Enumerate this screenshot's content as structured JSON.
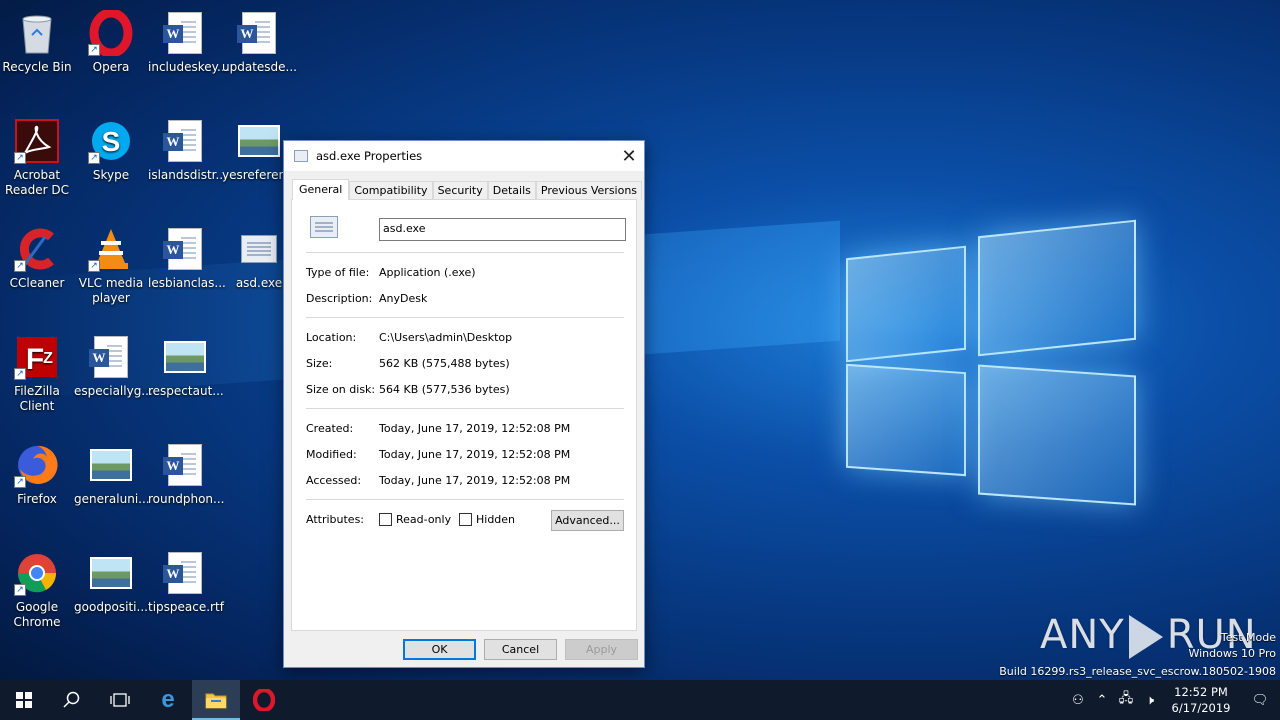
{
  "desktop": {
    "icons": [
      {
        "label": "Recycle Bin",
        "icon": "recycle-bin-icon"
      },
      {
        "label": "Opera",
        "icon": "opera-icon"
      },
      {
        "label": "includeskey...",
        "icon": "word-document-icon"
      },
      {
        "label": "updatesde...",
        "icon": "word-document-icon"
      },
      {
        "label": "Acrobat Reader DC",
        "icon": "acrobat-icon"
      },
      {
        "label": "Skype",
        "icon": "skype-icon"
      },
      {
        "label": "islandsdistr...",
        "icon": "word-document-icon"
      },
      {
        "label": "yesreferen...",
        "icon": "image-file-icon"
      },
      {
        "label": "CCleaner",
        "icon": "ccleaner-icon"
      },
      {
        "label": "VLC media player",
        "icon": "vlc-icon"
      },
      {
        "label": "lesbianclas...",
        "icon": "word-document-icon"
      },
      {
        "label": "asd.exe",
        "icon": "executable-icon"
      },
      {
        "label": "FileZilla Client",
        "icon": "filezilla-icon"
      },
      {
        "label": "especiallyg...",
        "icon": "word-document-icon"
      },
      {
        "label": "respectaut...",
        "icon": "image-file-icon"
      },
      {
        "label": "Firefox",
        "icon": "firefox-icon"
      },
      {
        "label": "generaluni...",
        "icon": "image-file-icon"
      },
      {
        "label": "roundphon...",
        "icon": "word-document-icon"
      },
      {
        "label": "Google Chrome",
        "icon": "chrome-icon"
      },
      {
        "label": "goodpositi...",
        "icon": "image-file-icon"
      },
      {
        "label": "tipspeace.rtf",
        "icon": "word-document-icon"
      }
    ]
  },
  "dialog": {
    "title": "asd.exe Properties",
    "tabs": [
      "General",
      "Compatibility",
      "Security",
      "Details",
      "Previous Versions"
    ],
    "file_name": "asd.exe",
    "type_label": "Type of file:",
    "type_value": "Application (.exe)",
    "description_label": "Description:",
    "description_value": "AnyDesk",
    "location_label": "Location:",
    "location_value": "C:\\Users\\admin\\Desktop",
    "size_label": "Size:",
    "size_value": "562 KB (575,488 bytes)",
    "size_on_disk_label": "Size on disk:",
    "size_on_disk_value": "564 KB (577,536 bytes)",
    "created_label": "Created:",
    "created_value": "Today, June 17, 2019, 12:52:08 PM",
    "modified_label": "Modified:",
    "modified_value": "Today, June 17, 2019, 12:52:08 PM",
    "accessed_label": "Accessed:",
    "accessed_value": "Today, June 17, 2019, 12:52:08 PM",
    "attributes_label": "Attributes:",
    "readonly_label": "Read-only",
    "hidden_label": "Hidden",
    "advanced_label": "Advanced...",
    "ok_label": "OK",
    "cancel_label": "Cancel",
    "apply_label": "Apply"
  },
  "watermark": {
    "brand_left": "ANY",
    "brand_right": "RUN",
    "mode": "Test Mode",
    "edition": "Windows 10 Pro",
    "build": "Build 16299.rs3_release_svc_escrow.180502-1908"
  },
  "taskbar": {
    "time": "12:52 PM",
    "date": "6/17/2019"
  }
}
